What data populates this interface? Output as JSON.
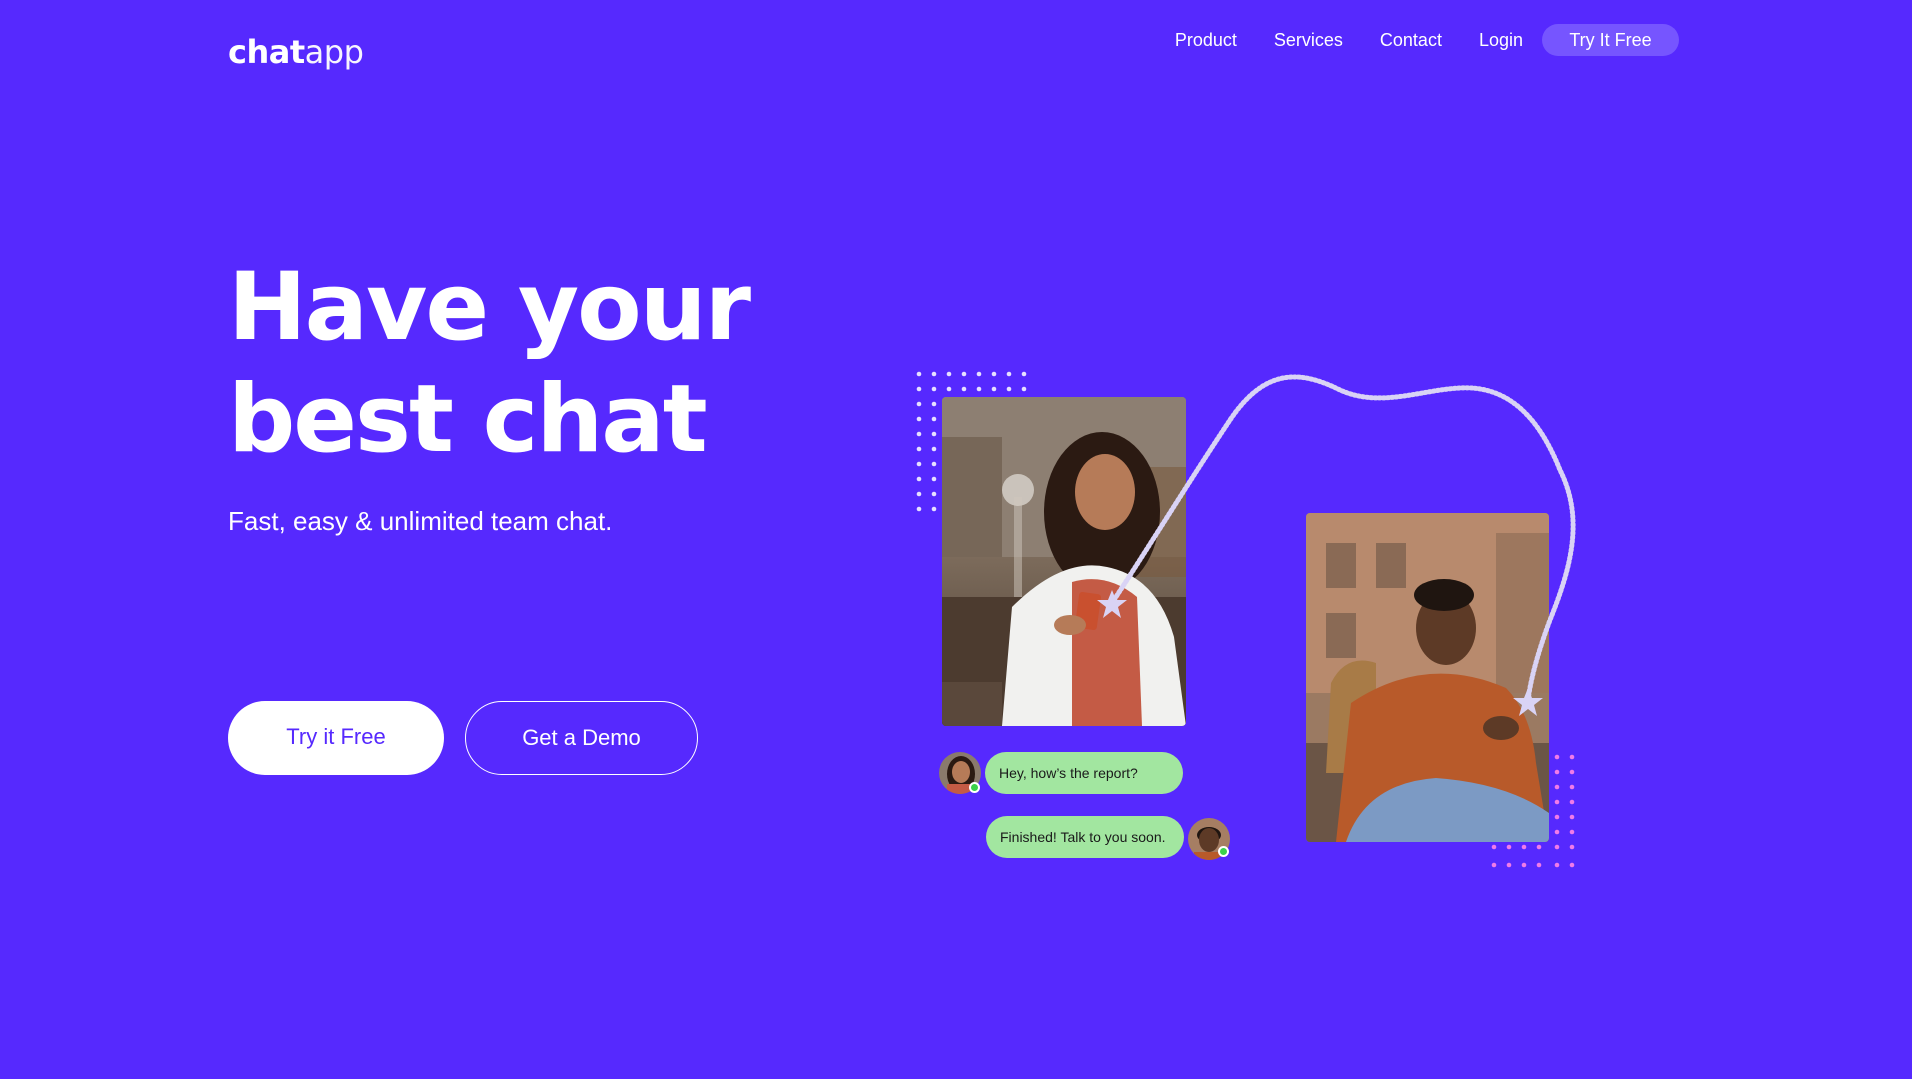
{
  "header": {
    "logo": {
      "bold": "chat",
      "light": "app"
    },
    "nav": [
      "Product",
      "Services",
      "Contact",
      "Login"
    ],
    "cta": "Try It Free"
  },
  "hero": {
    "headline_line1": "Have your",
    "headline_line2": "best chat",
    "subline": "Fast, easy & unlimited team chat.",
    "primary_button": "Try it Free",
    "secondary_button": "Get a Demo"
  },
  "chat": {
    "message_1": "Hey, how’s the report?",
    "message_2": "Finished! Talk to you soon."
  },
  "colors": {
    "background": "#5629FE",
    "nav_cta": "#7655FF",
    "bubble": "#A2E6A0",
    "online": "#3BD14A",
    "dots_white": "#E6E0FF",
    "dots_pink": "#F07BE8"
  },
  "icons": [
    "online-status-icon",
    "dot-pattern",
    "dashed-connector-path"
  ]
}
